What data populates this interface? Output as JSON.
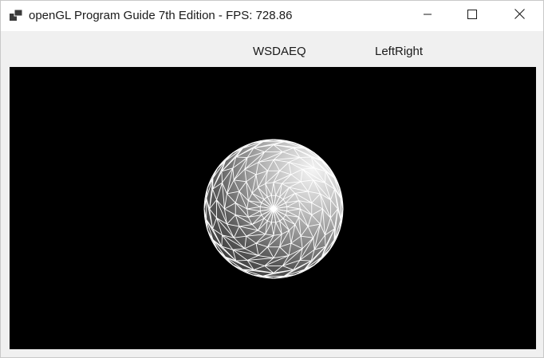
{
  "window": {
    "title": "openGL Program Guide 7th Edition - FPS: 728.86"
  },
  "toolbar": {
    "wsdaeq_label": "WSDAEQ",
    "leftright_label": "LeftRight"
  },
  "viewport": {
    "background": "#000000",
    "object": "wireframe-sphere",
    "wire_color": "#ffffff"
  },
  "icons": {
    "app": "app-icon",
    "minimize": "minimize-icon",
    "maximize": "maximize-icon",
    "close": "close-icon"
  }
}
